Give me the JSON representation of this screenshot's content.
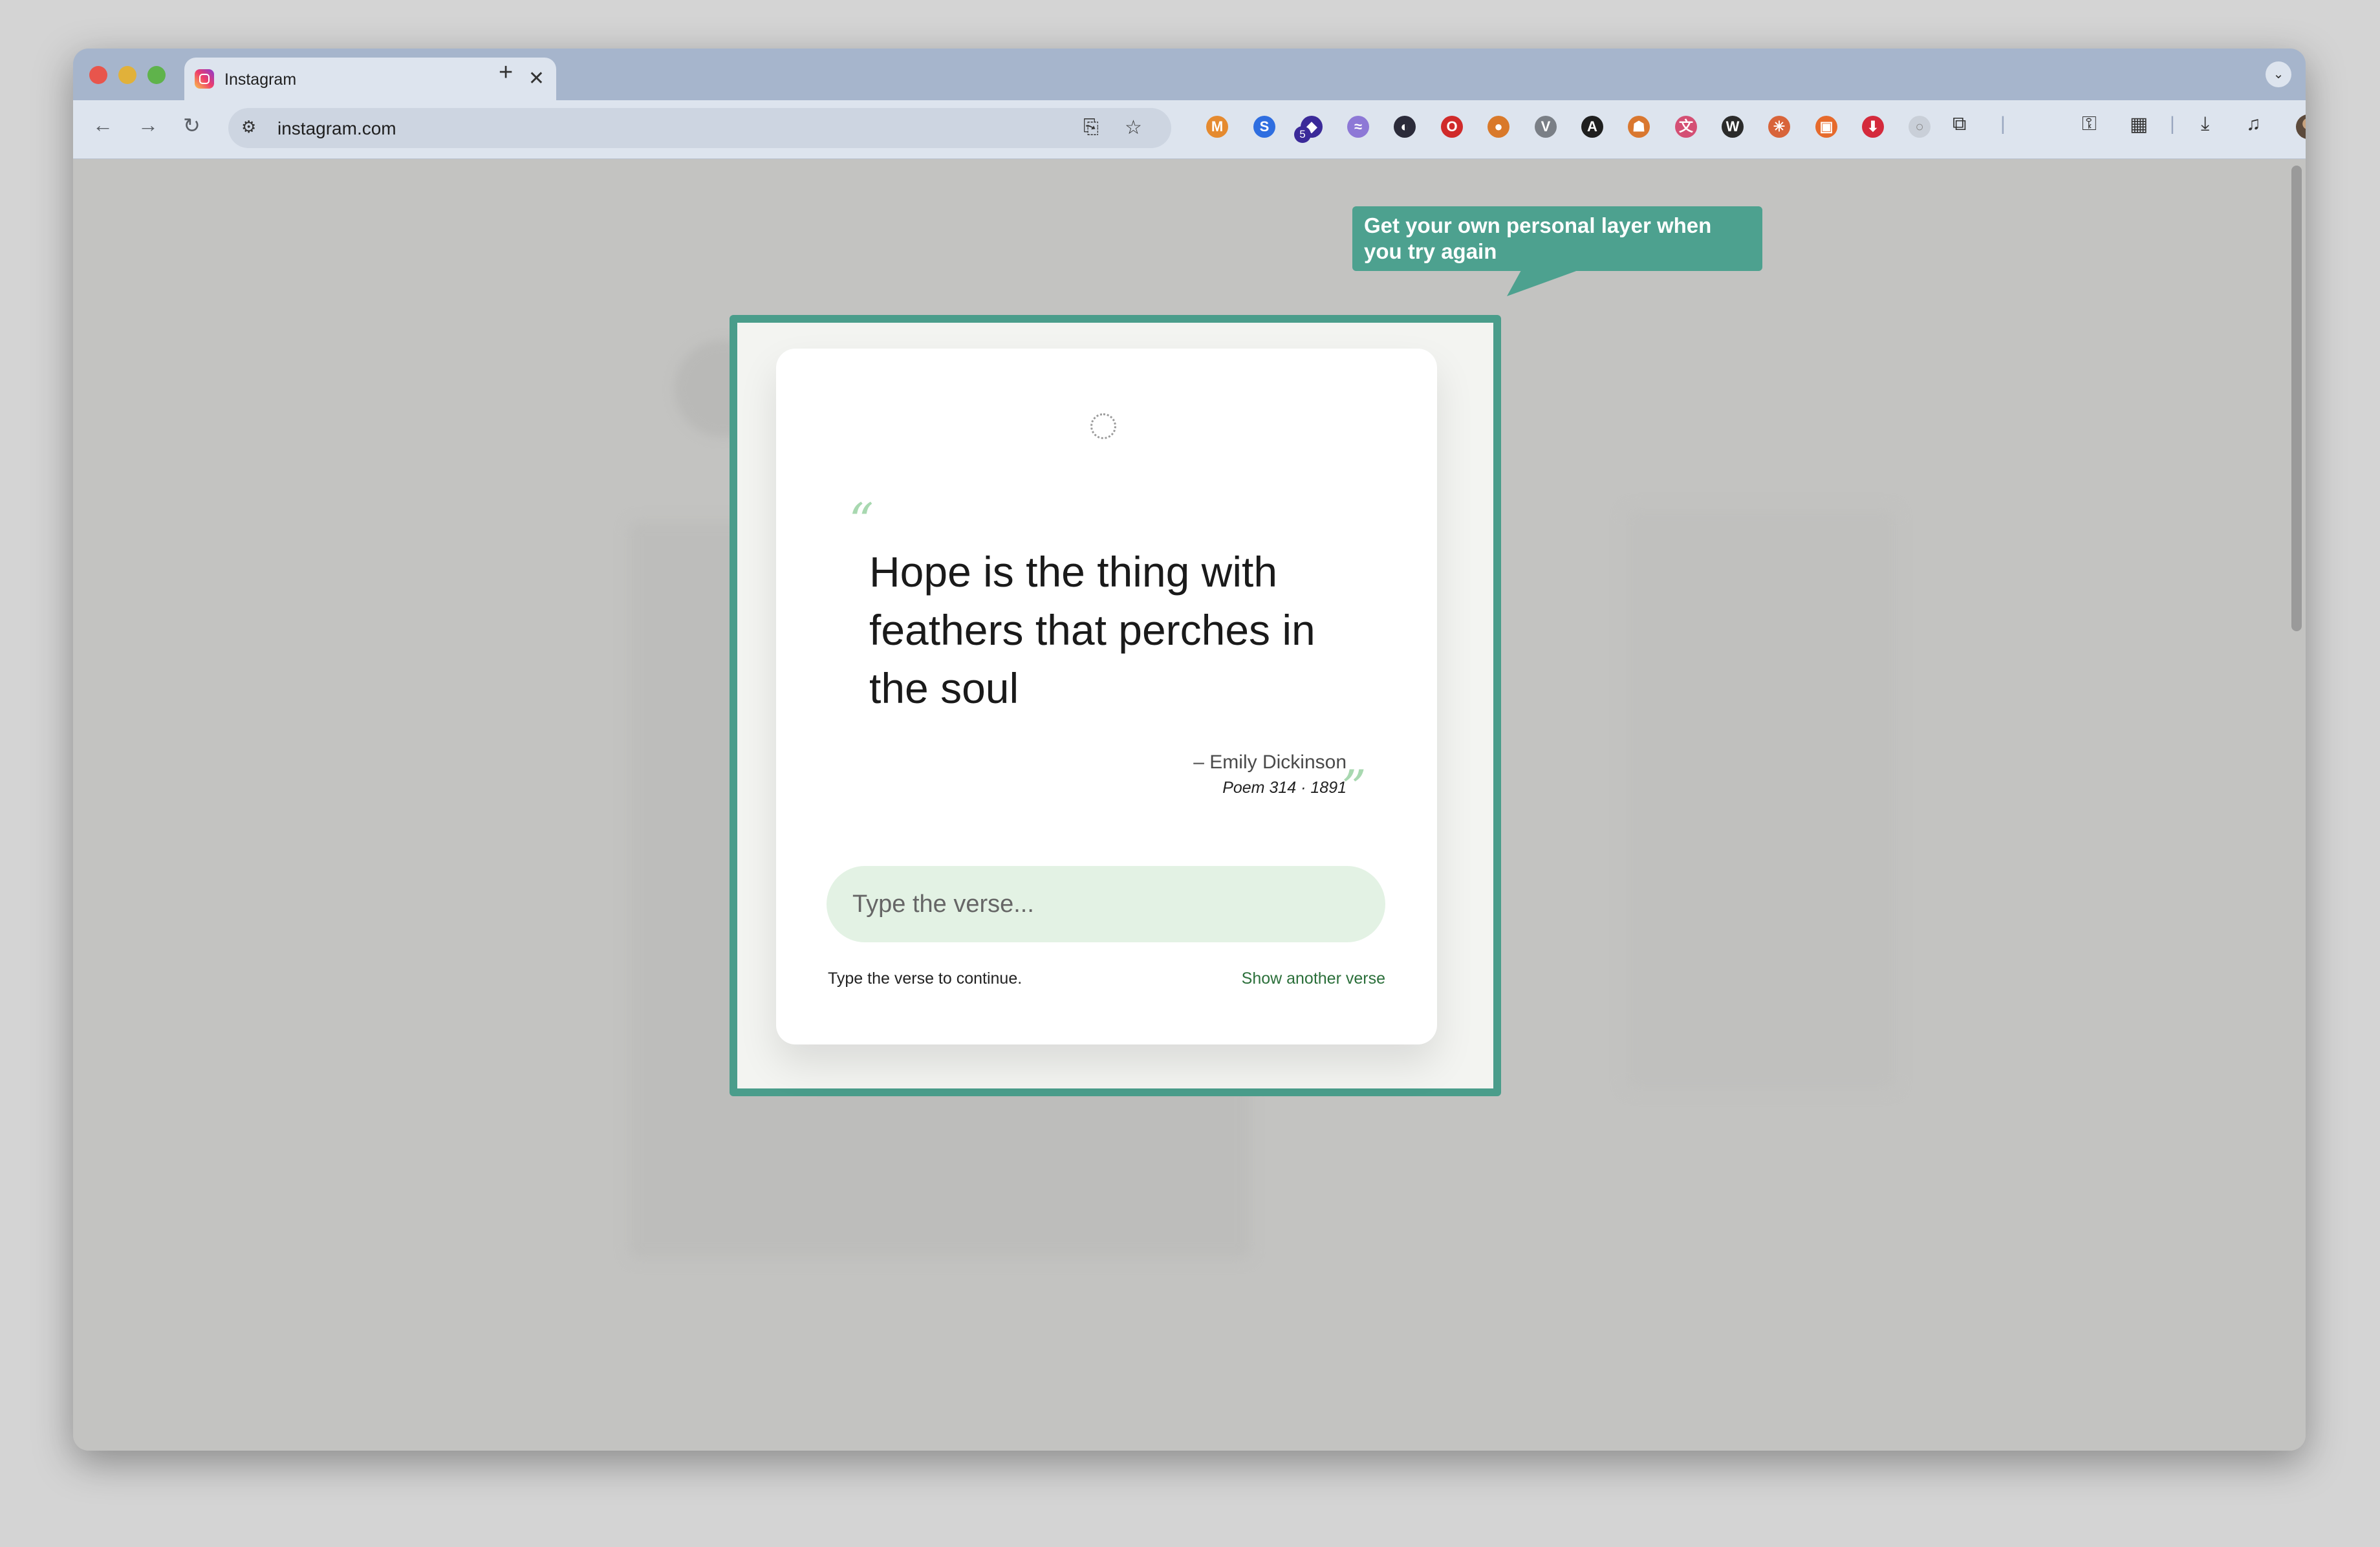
{
  "browser": {
    "tab": {
      "title": "Instagram"
    },
    "new_tab_symbol": "+",
    "close_symbol": "✕",
    "address": {
      "url": "instagram.com"
    },
    "extension_badge": "5"
  },
  "tooltip": {
    "text": "Get your own personal layer when you try again"
  },
  "modal": {
    "quote": "Hope is the thing with feathers that perches in the soul",
    "open_quote_mark": "“",
    "close_quote_mark": "”",
    "author": "– Emily Dickinson",
    "source": "Poem 314 · 1891",
    "input": {
      "placeholder": "Type the verse...",
      "value": ""
    },
    "hint": "Type the verse to continue.",
    "another_link": "Show another verse"
  },
  "colors": {
    "accent": "#4a9d8b",
    "tooltip_bg": "#4da18f",
    "input_bg": "#e3f2e4",
    "quote_mark": "#a8d8b0",
    "link": "#2b6f3a"
  },
  "icons": [
    "back-icon",
    "forward-icon",
    "reload-icon",
    "site-info-icon",
    "install-icon",
    "bookmark-star-icon",
    "metamask-icon",
    "shazam-icon",
    "extension-badge-icon",
    "radio-icon",
    "extension-icon",
    "opera-icon",
    "color-icon",
    "vee-icon",
    "x-icon",
    "robot-icon",
    "translate-icon",
    "wiki-icon",
    "claude-icon",
    "image-icon",
    "pocket-icon",
    "puzzle-icon",
    "password-key-icon",
    "qr-icon",
    "download-icon",
    "media-control-icon",
    "avatar",
    "kebab-menu-icon"
  ]
}
